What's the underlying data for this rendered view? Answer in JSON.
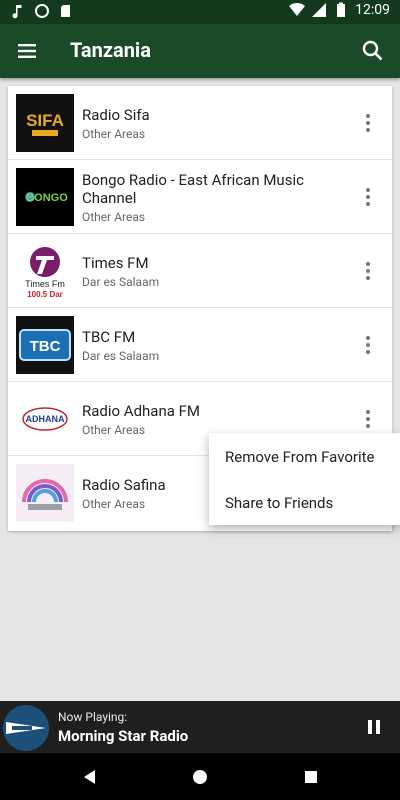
{
  "status_bar": {
    "time": "12:09"
  },
  "app_bar": {
    "title": "Tanzania"
  },
  "stations": [
    {
      "name": "Radio Sifa",
      "area": "Other Areas",
      "logo": "sifa-radio-logo",
      "logo_text": "SIFA"
    },
    {
      "name": "Bongo Radio - East African Music Channel",
      "area": "Other Areas",
      "logo": "bongo-radio-logo",
      "logo_text": "BONGO"
    },
    {
      "name": "Times FM",
      "area": "Dar es Salaam",
      "logo": "times-fm-logo",
      "logo_text": "Times Fm",
      "logo_sub": "100.5 Dar"
    },
    {
      "name": "TBC FM",
      "area": "Dar es Salaam",
      "logo": "tbc-fm-logo",
      "logo_text": "TBC"
    },
    {
      "name": "Radio Adhana FM",
      "area": "Other Areas",
      "logo": "adhana-fm-logo",
      "logo_text": "ADHANA"
    },
    {
      "name": "Radio Safina",
      "area": "Other Areas",
      "logo": "safina-radio-logo"
    }
  ],
  "popup_menu": {
    "items": [
      "Remove From Favorite",
      "Share to Friends"
    ]
  },
  "now_playing": {
    "label": "Now Playing:",
    "title": "Morning Star Radio"
  },
  "colors": {
    "status_bar": "#133a1c",
    "app_bar": "#1b4a28",
    "background": "#e6e6e6",
    "now_bar": "#1f1f1f"
  }
}
